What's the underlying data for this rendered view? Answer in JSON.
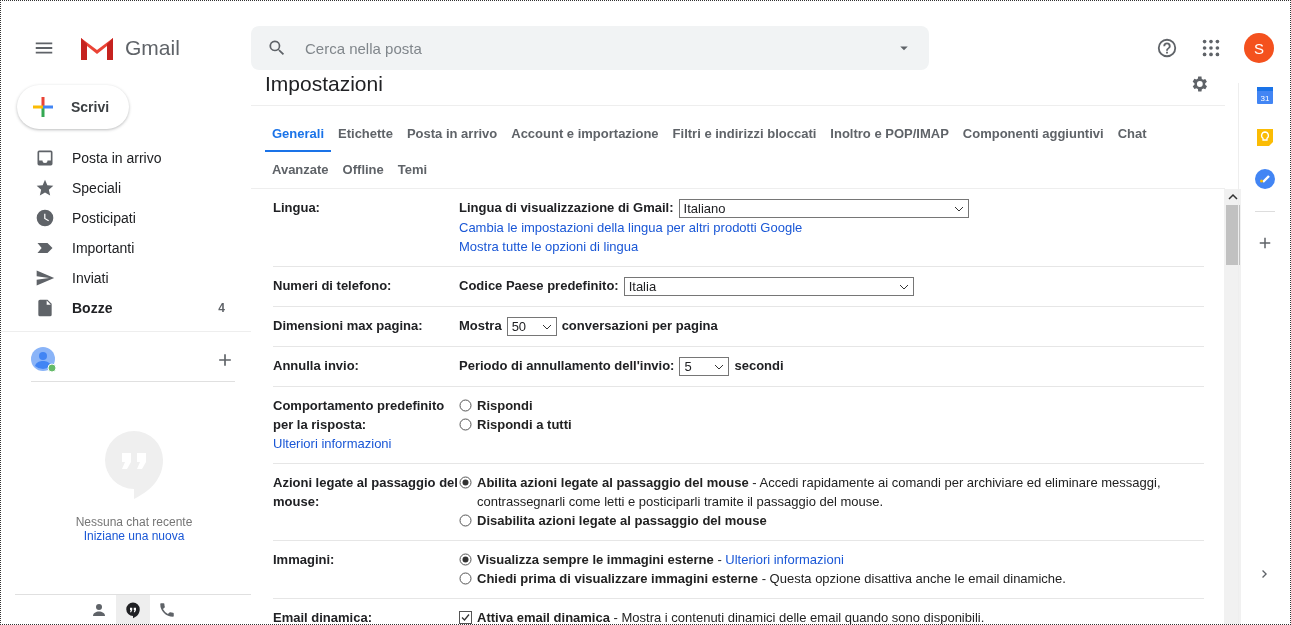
{
  "header": {
    "app_name": "Gmail",
    "search": {
      "placeholder": "Cerca nella posta"
    },
    "avatar_letter": "S"
  },
  "sidebar": {
    "compose": "Scrivi",
    "items": [
      {
        "kind": "inbox",
        "label": "Posta in arrivo",
        "bold": false
      },
      {
        "kind": "star",
        "label": "Speciali",
        "bold": false
      },
      {
        "kind": "clock",
        "label": "Posticipati",
        "bold": false
      },
      {
        "kind": "label",
        "label": "Importanti",
        "bold": false
      },
      {
        "kind": "send",
        "label": "Inviati",
        "bold": false
      },
      {
        "kind": "draft",
        "label": "Bozze",
        "bold": true,
        "count": "4"
      }
    ],
    "hangouts": {
      "online": true,
      "empty_text": "Nessuna chat recente",
      "start_link": "Iniziane una nuova"
    },
    "bottom_tabs": [
      {
        "kind": "person",
        "selected": false
      },
      {
        "kind": "chat",
        "selected": true
      },
      {
        "kind": "phone",
        "selected": false
      }
    ]
  },
  "settings": {
    "title": "Impostazioni",
    "tabs": [
      {
        "label": "Generali",
        "selected": true
      },
      {
        "label": "Etichette",
        "selected": false
      },
      {
        "label": "Posta in arrivo",
        "selected": false
      },
      {
        "label": "Account e importazione",
        "selected": false
      },
      {
        "label": "Filtri e indirizzi bloccati",
        "selected": false
      },
      {
        "label": "Inoltro e POP/IMAP",
        "selected": false
      },
      {
        "label": "Componenti aggiuntivi",
        "selected": false
      },
      {
        "label": "Chat",
        "selected": false
      },
      {
        "label": "Avanzate",
        "selected": false
      },
      {
        "label": "Offline",
        "selected": false
      },
      {
        "label": "Temi",
        "selected": false
      }
    ],
    "rows": [
      {
        "label": "Lingua:",
        "items": [
          {
            "kind": "wide_select",
            "prefix": "Lingua di visualizzazione di Gmail:",
            "value": "Italiano"
          },
          {
            "kind": "link",
            "text": "Cambia le impostazioni della lingua per altri prodotti Google"
          },
          {
            "kind": "link",
            "text": "Mostra tutte le opzioni di lingua"
          }
        ]
      },
      {
        "label": "Numeri di telefono:",
        "items": [
          {
            "kind": "wide_select",
            "prefix": "Codice Paese predefinito:",
            "value": "Italia"
          }
        ]
      },
      {
        "label": "Dimensioni max pagina:",
        "items": [
          {
            "kind": "small_select",
            "prefix": "Mostra",
            "value": "50",
            "suffix": "conversazioni per pagina"
          }
        ]
      },
      {
        "label": "Annulla invio:",
        "items": [
          {
            "kind": "small_select",
            "prefix": "Periodo di annullamento dell'invio:",
            "value": "5",
            "suffix": "secondi"
          }
        ]
      },
      {
        "label": "Comportamento predefinito per la risposta:",
        "link": "Ulteriori informazioni",
        "items": [
          {
            "kind": "radio",
            "label": "Rispondi",
            "selected": false
          },
          {
            "kind": "radio",
            "label": "Rispondi a tutti",
            "selected": false
          }
        ]
      },
      {
        "label": "Azioni legate al passaggio del mouse:",
        "items": [
          {
            "kind": "radio",
            "label": "Abilita azioni legate al passaggio del mouse",
            "description": " - Accedi rapidamente ai comandi per archiviare ed eliminare messaggi, contrassegnarli come letti e posticiparli tramite il passaggio del mouse.",
            "selected": true
          },
          {
            "kind": "radio",
            "label": "Disabilita azioni legate al passaggio del mouse",
            "selected": false
          }
        ]
      },
      {
        "label": "Immagini:",
        "items": [
          {
            "kind": "radio",
            "label": "Visualizza sempre le immagini esterne",
            "description": " - ",
            "link": "Ulteriori informazioni",
            "selected": true
          },
          {
            "kind": "radio",
            "label": "Chiedi prima di visualizzare immagini esterne",
            "description": " - Questa opzione disattiva anche le email dinamiche.",
            "selected": false
          }
        ]
      },
      {
        "label": "Email dinamica:",
        "items": [
          {
            "kind": "checkbox",
            "label": "Attiva email dinamica",
            "description": " - Mostra i contenuti dinamici delle email quando sono disponibili.",
            "checked": true
          }
        ]
      }
    ]
  },
  "side_panel": {
    "calendar_day": "31"
  }
}
